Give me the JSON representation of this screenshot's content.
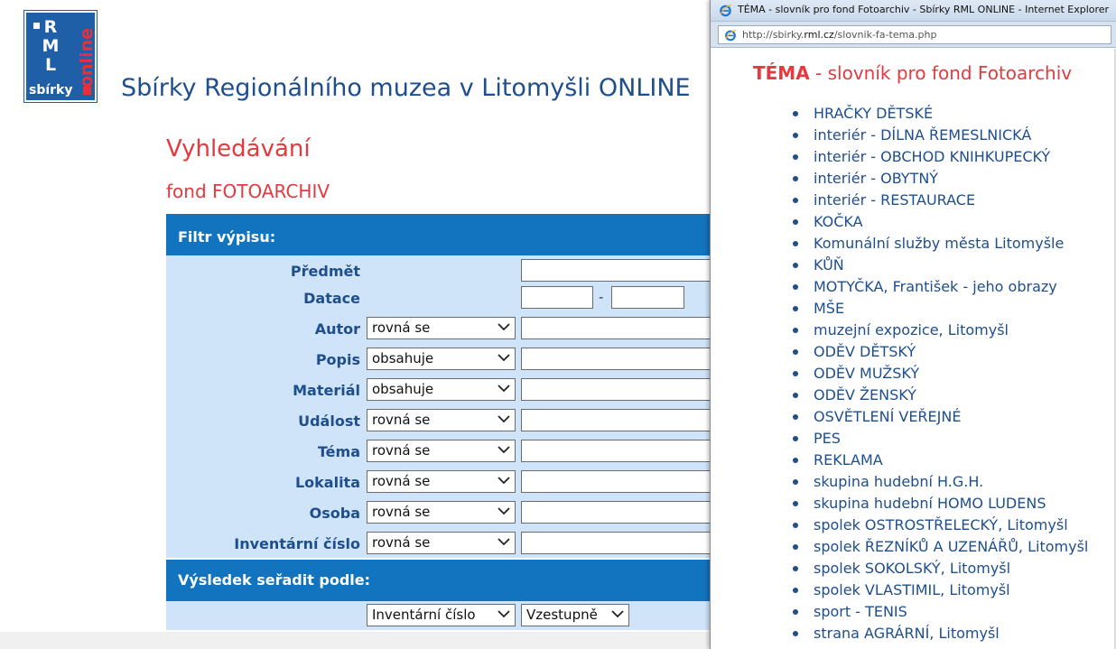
{
  "site": {
    "logo_letters": [
      "R",
      "M",
      "L"
    ],
    "logo_online": "online",
    "logo_sbirky": "sbírky",
    "title": "Sbírky Regionálního muzea v Litomyšli ONLINE"
  },
  "page": {
    "heading": "Vyhledávání",
    "fond": "fond FOTOARCHIV"
  },
  "filter": {
    "header": "Filtr výpisu:",
    "rows": [
      {
        "label": "Předmět"
      },
      {
        "label": "Datace",
        "separator": "-"
      },
      {
        "label": "Autor",
        "operator": "rovná se"
      },
      {
        "label": "Popis",
        "operator": "obsahuje"
      },
      {
        "label": "Materiál",
        "operator": "obsahuje"
      },
      {
        "label": "Událost",
        "operator": "rovná se"
      },
      {
        "label": "Téma",
        "operator": "rovná se"
      },
      {
        "label": "Lokalita",
        "operator": "rovná se"
      },
      {
        "label": "Osoba",
        "operator": "rovná se"
      },
      {
        "label": "Inventární číslo",
        "operator": "rovná se"
      }
    ]
  },
  "sort": {
    "header": "Výsledek seřadit podle:",
    "field": "Inventární číslo",
    "order": "Vzestupně"
  },
  "popup": {
    "window_title": "TÉMA - slovník pro fond Fotoarchiv - Sbírky RML ONLINE - Internet Explorer",
    "url_prefix": "http://sbirky.",
    "url_domain": "rml.cz",
    "url_path": "/slovnik-fa-tema.php",
    "heading_bold": "TÉMA",
    "heading_rest": " - slovník pro fond Fotoarchiv",
    "items": [
      "HRAČKY DĚTSKÉ",
      "interiér - DÍLNA ŘEMESLNICKÁ",
      "interiér - OBCHOD KNIHKUPECKÝ",
      "interiér - OBYTNÝ",
      "interiér - RESTAURACE",
      "KOČKA",
      "Komunální služby města Litomyšle",
      "KŮŇ",
      "MOTYČKA, František - jeho obrazy",
      "MŠE",
      "muzejní expozice, Litomyšl",
      "ODĚV DĚTSKÝ",
      "ODĚV MUŽSKÝ",
      "ODĚV ŽENSKÝ",
      "OSVĚTLENÍ VEŘEJNÉ",
      "PES",
      "REKLAMA",
      "skupina hudební H.G.H.",
      "skupina hudební HOMO LUDENS",
      "spolek OSTROSTŘELECKÝ, Litomyšl",
      "spolek ŘEZNÍKŮ A UZENÁŘŮ, Litomyšl",
      "spolek SOKOLSKÝ, Litomyšl",
      "spolek VLASTIMIL, Litomyšl",
      "sport - TENIS",
      "strana AGRÁRNÍ, Litomyšl"
    ]
  },
  "colors": {
    "accent_blue": "#1274bf",
    "panel_blue": "#cfe4f8",
    "label_blue": "#1f4e8c",
    "heading_red": "#e4393f"
  }
}
